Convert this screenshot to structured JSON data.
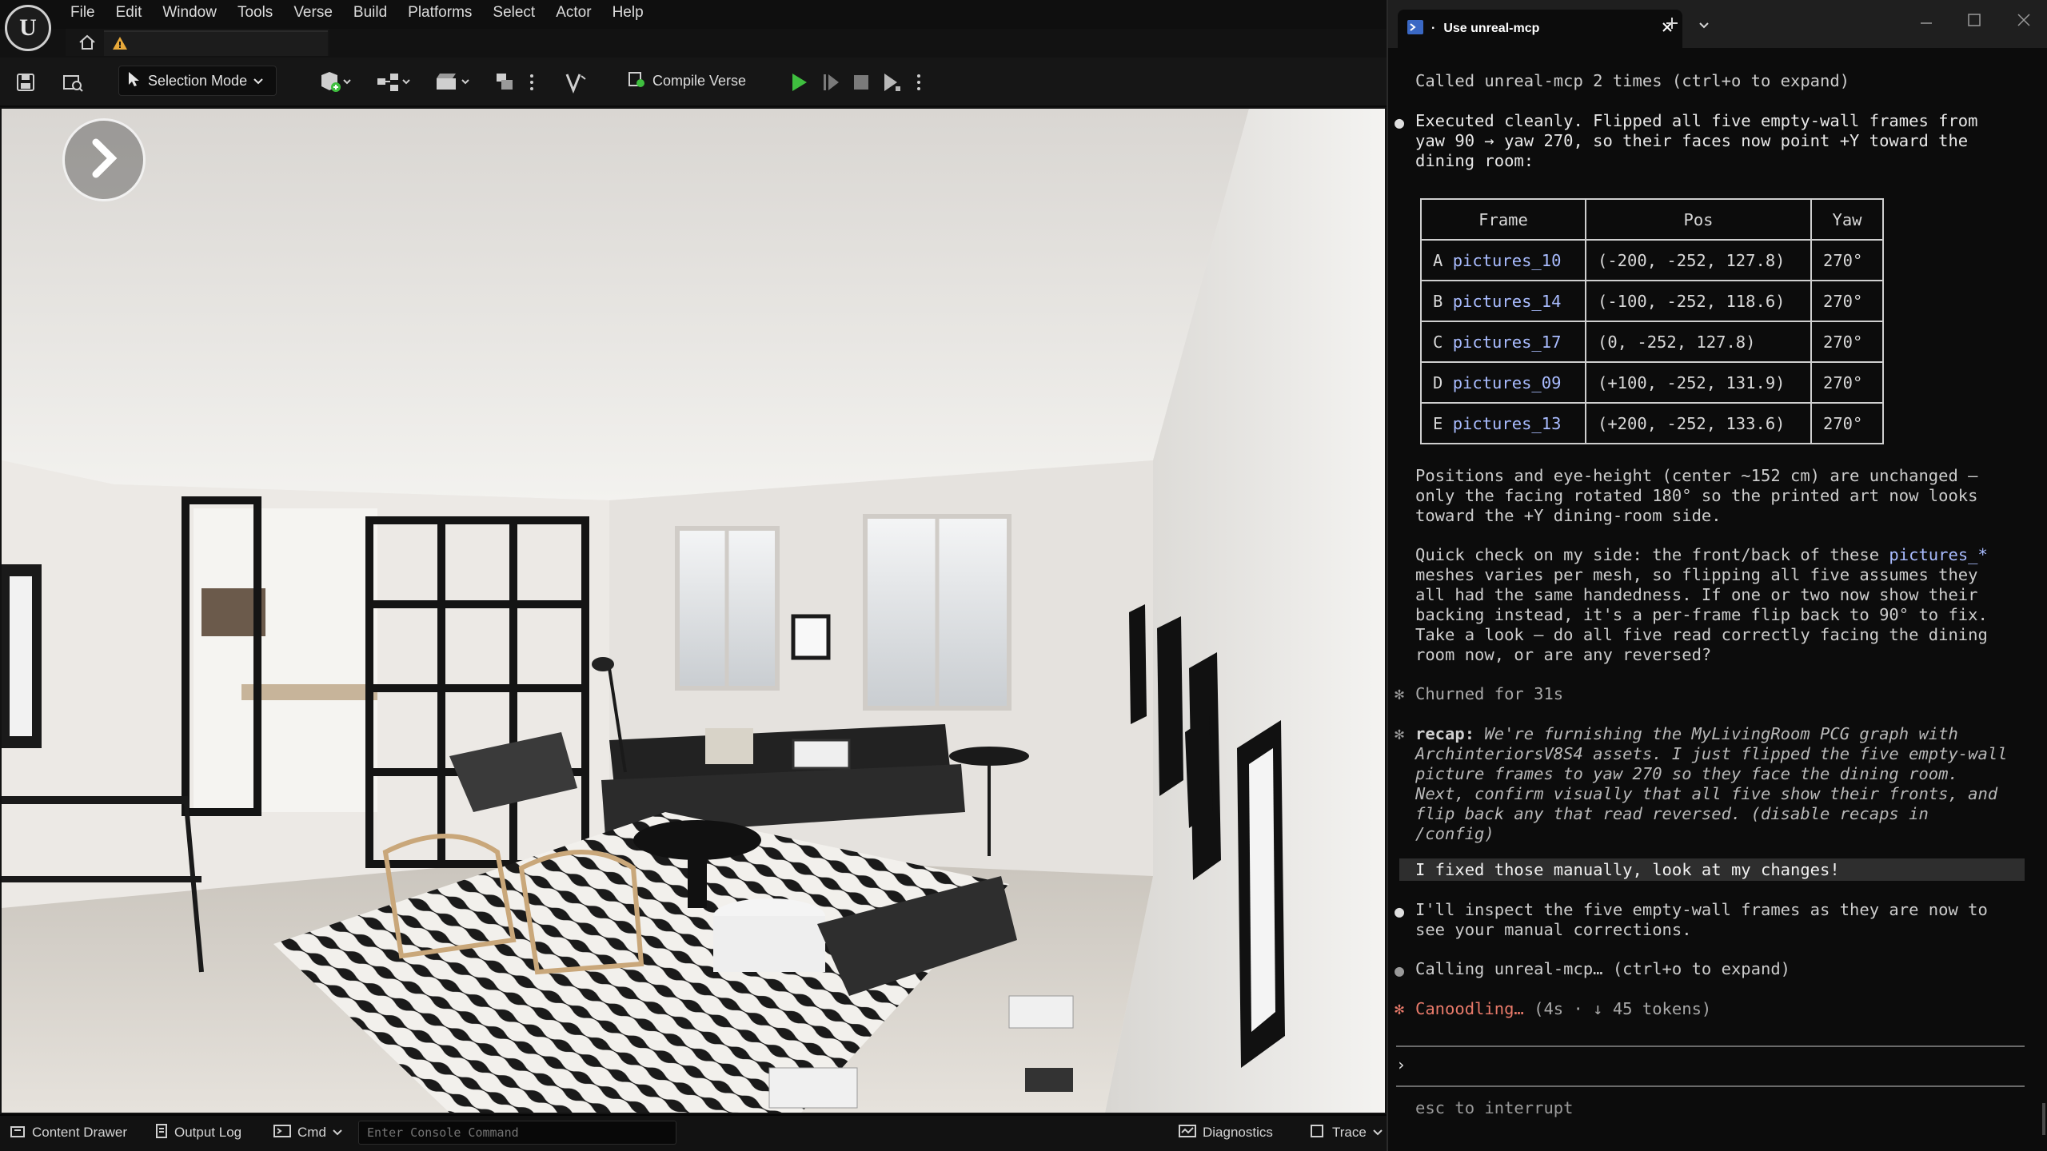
{
  "editor": {
    "menu": [
      "File",
      "Edit",
      "Window",
      "Tools",
      "Verse",
      "Build",
      "Platforms",
      "Select",
      "Actor",
      "Help"
    ],
    "toolbar": {
      "selection_mode": "Selection Mode",
      "compile_verse": "Compile Verse"
    },
    "statusbar": {
      "content_drawer": "Content Drawer",
      "output_log": "Output Log",
      "cmd": "Cmd",
      "console_placeholder": "Enter Console Command",
      "diagnostics": "Diagnostics",
      "trace": "Trace"
    }
  },
  "terminal": {
    "tab_title": "Use unreal-mcp",
    "lines": {
      "called": "Called unreal-mcp 2 times (ctrl+o to expand)",
      "exec1": "Executed cleanly. Flipped all five empty-wall frames from",
      "exec2": "yaw 90 → yaw 270, so their faces now point +Y toward the",
      "exec3": "dining room:",
      "pos1": "Positions and eye-height (center ~152 cm) are unchanged —",
      "pos2": "only the facing rotated 180° so the printed art now looks",
      "pos3": "toward the +Y dining-room side.",
      "q1a": "Quick check on my side: the front/back of these ",
      "q1b": "pictures_*",
      "q2": "meshes varies per mesh, so flipping all five assumes they",
      "q3": "all had the same handedness. If one or two now show their",
      "q4": "backing instead, it's a per-frame flip back to 90° to fix.",
      "q5": "Take a look — do all five read correctly facing the dining",
      "q6": "room now, or are any reversed?",
      "churned": "Churned for 31s",
      "recap_label": "recap:",
      "recap1": " We're furnishing the MyLivingRoom PCG graph with",
      "recap2": "ArchinteriorsV8S4 assets. I just flipped the five empty-wall",
      "recap3": "picture frames to yaw 270 so they face the dining room.",
      "recap4": "Next, confirm visually that all five show their fronts, and",
      "recap5": "flip back any that read reversed. (disable recaps in",
      "recap6": "/config)",
      "user_msg": "I fixed those manually, look at my changes!",
      "inspect1": "I'll inspect the five empty-wall frames as they are now to",
      "inspect2": "see your manual corrections.",
      "calling": "Calling unreal-mcp… (ctrl+o to expand)",
      "canoodling": "Canoodling…",
      "canoodling_meta": " (4s · ↓ 45 tokens)",
      "prompt": "›",
      "esc": "esc to interrupt"
    },
    "table": {
      "headers": [
        "Frame",
        "Pos",
        "Yaw"
      ],
      "rows": [
        {
          "letter": "A",
          "name": "pictures_10",
          "pos": "(-200, -252, 127.8)",
          "yaw": "270°"
        },
        {
          "letter": "B",
          "name": "pictures_14",
          "pos": "(-100, -252, 118.6)",
          "yaw": "270°"
        },
        {
          "letter": "C",
          "name": "pictures_17",
          "pos": "(0, -252, 127.8)",
          "yaw": "270°"
        },
        {
          "letter": "D",
          "name": "pictures_09",
          "pos": "(+100, -252, 131.9)",
          "yaw": "270°"
        },
        {
          "letter": "E",
          "name": "pictures_13",
          "pos": "(+200, -252, 133.6)",
          "yaw": "270°"
        }
      ]
    }
  },
  "colors": {
    "accent_link": "#a9bcff",
    "canoodling": "#e87a6a",
    "play_green": "#3fbf3f"
  }
}
